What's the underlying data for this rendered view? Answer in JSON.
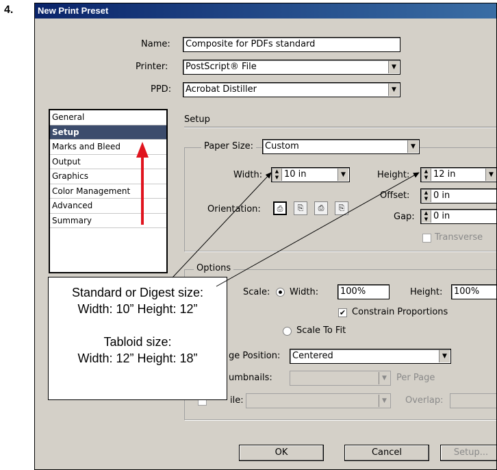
{
  "step_number": "4.",
  "window": {
    "title": "New Print Preset"
  },
  "fields": {
    "name_label": "Name:",
    "name_value": "Composite for PDFs standard",
    "printer_label": "Printer:",
    "printer_value": "PostScript® File",
    "ppd_label": "PPD:",
    "ppd_value": "Acrobat Distiller"
  },
  "sidebar": {
    "items": [
      {
        "label": "General",
        "selected": false
      },
      {
        "label": "Setup",
        "selected": true
      },
      {
        "label": "Marks and Bleed",
        "selected": false
      },
      {
        "label": "Output",
        "selected": false
      },
      {
        "label": "Graphics",
        "selected": false
      },
      {
        "label": "Color Management",
        "selected": false
      },
      {
        "label": "Advanced",
        "selected": false
      },
      {
        "label": "Summary",
        "selected": false
      }
    ]
  },
  "setup": {
    "heading": "Setup",
    "paper_size_label": "Paper Size:",
    "paper_size_value": "Custom",
    "width_label": "Width:",
    "width_value": "10 in",
    "height_label": "Height:",
    "height_value": "12 in",
    "orientation_label": "Orientation:",
    "offset_label": "Offset:",
    "offset_value": "0 in",
    "gap_label": "Gap:",
    "gap_value": "0 in",
    "transverse_label": "Transverse"
  },
  "options": {
    "heading": "Options",
    "scale_label": "Scale:",
    "scale_width_label": "Width:",
    "scale_width_value": "100%",
    "scale_height_label": "Height:",
    "scale_height_value": "100%",
    "constrain_label": "Constrain Proportions",
    "scale_to_fit_label": "Scale To Fit",
    "page_position_label_visible": "ge Position:",
    "page_position_value": "Centered",
    "thumbnails_label_visible": "umbnails:",
    "per_page_label": "Per Page",
    "tile_label_visible": "ile:",
    "overlap_label": "Overlap:"
  },
  "buttons": {
    "ok": "OK",
    "cancel": "Cancel",
    "setup": "Setup..."
  },
  "callout": {
    "line1": "Standard or Digest size:",
    "line2": "Width: 10” Height: 12”",
    "line3": "Tabloid size:",
    "line4": "Width: 12” Height: 18”"
  },
  "colors": {
    "title_bar": "#0a246a",
    "selected_item": "#3c4c6c",
    "arrow": "#e0141e",
    "dialog_bg": "#d4d0c8"
  }
}
